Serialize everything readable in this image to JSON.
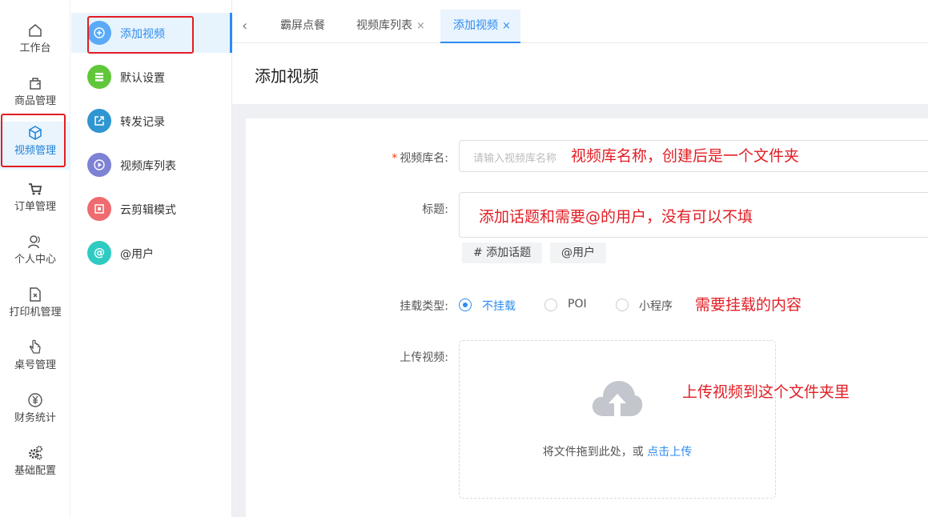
{
  "nav_primary": [
    {
      "label": "工作台",
      "icon": "home-icon"
    },
    {
      "label": "商品管理",
      "icon": "bag-icon"
    },
    {
      "label": "视频管理",
      "icon": "cube-icon"
    },
    {
      "label": "订单管理",
      "icon": "cart-icon"
    },
    {
      "label": "个人中心",
      "icon": "user-icon"
    },
    {
      "label": "打印机管理",
      "icon": "document-icon"
    },
    {
      "label": "桌号管理",
      "icon": "hand-icon"
    },
    {
      "label": "财务统计",
      "icon": "yen-icon"
    },
    {
      "label": "基础配置",
      "icon": "gears-icon"
    }
  ],
  "nav_secondary": [
    {
      "label": "添加视频",
      "icon": "plus-circle-icon",
      "color": "#5aaaf7"
    },
    {
      "label": "默认设置",
      "icon": "list-icon",
      "color": "#60c73a"
    },
    {
      "label": "转发记录",
      "icon": "share-icon",
      "color": "#2f96d2"
    },
    {
      "label": "视频库列表",
      "icon": "play-icon",
      "color": "#7d82d4"
    },
    {
      "label": "云剪辑模式",
      "icon": "film-icon",
      "color": "#ee6b6f"
    },
    {
      "label": "@用户",
      "icon": "at-icon",
      "color": "#2fcbc2"
    }
  ],
  "tabs": {
    "items": [
      "霸屏点餐",
      "视频库列表",
      "添加视频"
    ],
    "close": "×"
  },
  "page": {
    "title": "添加视频"
  },
  "form": {
    "required_mark": "*",
    "library_label": "视频库名:",
    "library_placeholder": "请输入视频库名称",
    "title_label": "标题:",
    "chip_topic": "# 添加话题",
    "chip_user": "@用户",
    "mount_label": "挂载类型:",
    "mount_options": [
      "不挂载",
      "POI",
      "小程序"
    ],
    "upload_label": "上传视频:",
    "upload_text": "将文件拖到此处，或",
    "upload_link": "点击上传"
  },
  "annotations": [
    "视频库名称，创建后是一个文件夹",
    "添加话题和需要@的用户，没有可以不填",
    "需要挂载的内容",
    "上传视频到这个文件夹里"
  ],
  "colors": {
    "accent": "#2d8cf0",
    "annotation": "#e21d24"
  }
}
